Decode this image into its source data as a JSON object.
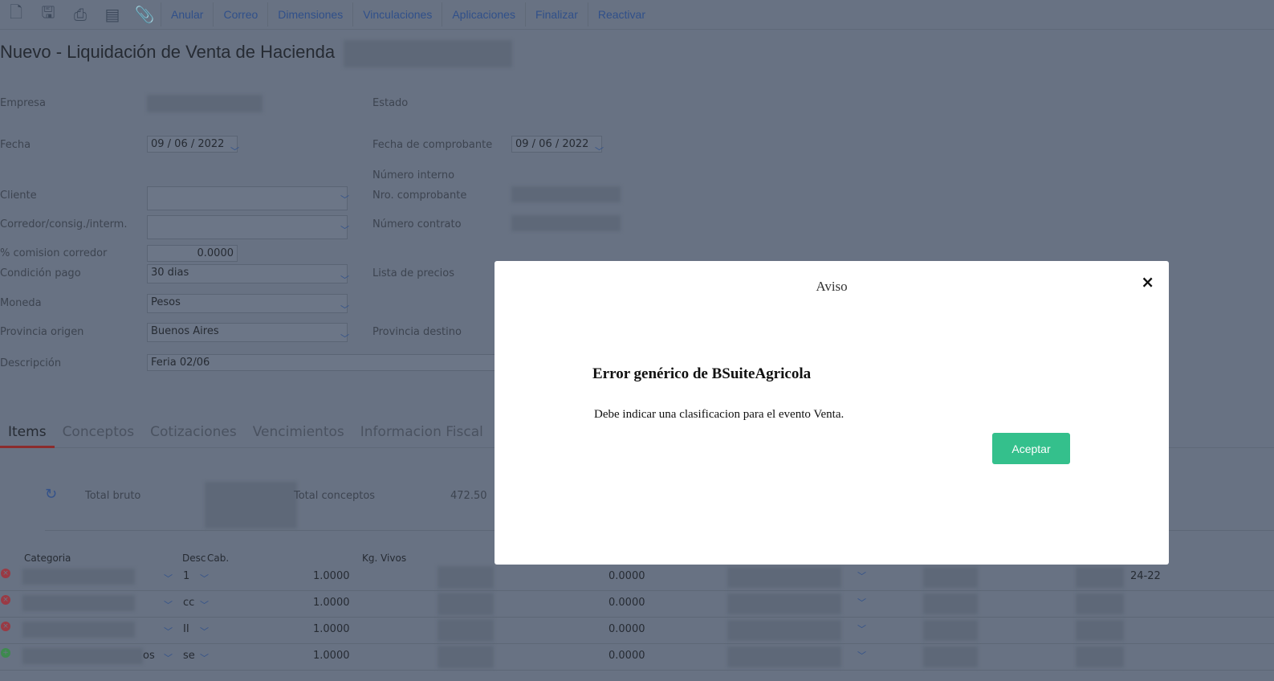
{
  "toolbar": {
    "icons": [
      "new-document-icon",
      "save-icon",
      "print-icon",
      "report-icon",
      "attach-icon"
    ],
    "links": [
      "Anular",
      "Correo",
      "Dimensiones",
      "Vinculaciones",
      "Aplicaciones",
      "Finalizar",
      "Reactivar"
    ]
  },
  "title": "Nuevo - Liquidación de Venta de Hacienda",
  "form": {
    "empresa": "Empresa",
    "estado": "Estado",
    "fecha": "Fecha",
    "fecha_value": "09 / 06 / 2022",
    "fecha_comprobante": "Fecha de comprobante",
    "fecha_comprobante_value": "09 / 06 / 2022",
    "numero_interno": "Número interno",
    "cliente": "Cliente",
    "nro_comprobante": "Nro. comprobante",
    "corredor": "Corredor/consig./interm.",
    "numero_contrato": "Número contrato",
    "comision": "% comision corredor",
    "comision_value": "0.0000",
    "condicion": "Condición pago",
    "condicion_value": "30 dias",
    "lista_precios": "Lista de precios",
    "moneda": "Moneda",
    "moneda_value": "Pesos",
    "provincia_origen": "Provincia origen",
    "provincia_origen_value": "Buenos Aires",
    "provincia_destino": "Provincia destino",
    "descripcion": "Descripción",
    "descripcion_value": "Feria 02/06"
  },
  "tabs": [
    "Items",
    "Conceptos",
    "Cotizaciones",
    "Vencimientos",
    "Informacion Fiscal"
  ],
  "totals": {
    "bruto": "Total bruto",
    "conceptos": "Total conceptos",
    "conceptos_value": "472.50"
  },
  "table": {
    "headers": [
      "Categoria",
      "Desc",
      "Cab.",
      "Kg. Vivos"
    ],
    "rows": [
      {
        "desc": "1",
        "cab": "1.0000",
        "v2": "0.0000",
        "extra": "24-22",
        "status": "remove"
      },
      {
        "desc": "cc",
        "cab": "1.0000",
        "v2": "0.0000",
        "extra": "",
        "status": "remove"
      },
      {
        "desc": "II",
        "cab": "1.0000",
        "v2": "0.0000",
        "extra": "",
        "status": "remove"
      },
      {
        "desc": "se",
        "cab": "1.0000",
        "v2": "0.0000",
        "extra": "",
        "status": "add",
        "cat_suffix": "os"
      }
    ]
  },
  "modal": {
    "title": "Aviso",
    "heading": "Error genérico de BSuiteAgricola",
    "message": "Debe indicar una clasificacion para el evento Venta.",
    "accept": "Aceptar",
    "close": "×",
    "accent": "#34c08c"
  }
}
